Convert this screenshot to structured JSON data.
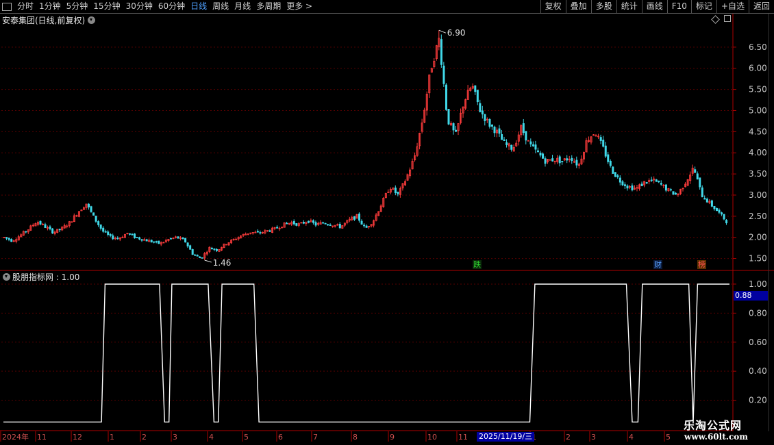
{
  "toolbar": {
    "left_items": [
      {
        "label": "分时"
      },
      {
        "label": "1分钟"
      },
      {
        "label": "5分钟"
      },
      {
        "label": "15分钟"
      },
      {
        "label": "30分钟"
      },
      {
        "label": "60分钟"
      },
      {
        "label": "日线",
        "active": true
      },
      {
        "label": "周线"
      },
      {
        "label": "月线"
      },
      {
        "label": "多周期"
      },
      {
        "label": "更多 >"
      }
    ],
    "right_items": [
      {
        "label": "复权"
      },
      {
        "label": "叠加"
      },
      {
        "label": "多股"
      },
      {
        "label": "统计"
      },
      {
        "label": "画线"
      },
      {
        "label": "F10"
      },
      {
        "label": "标记"
      },
      {
        "label": "+自选"
      },
      {
        "label": "返回"
      }
    ]
  },
  "main_panel": {
    "title": "安泰集团(日线,前复权)",
    "max_label": "6.90",
    "min_label": "1.46",
    "signals": [
      {
        "text": "跌",
        "color": "#2fd52f",
        "bg": "#0a2a0a"
      },
      {
        "text": "财",
        "color": "#5aa0ff",
        "bg": "#0a1a3a"
      },
      {
        "text": "榜",
        "color": "#ff5050",
        "bg": "#5a3000"
      }
    ]
  },
  "indicator_panel": {
    "title": "股朋指标网 : 1.00",
    "current_value": "0.88"
  },
  "watermark": {
    "line1": "乐淘公式网",
    "line2": "www.60lt.com"
  },
  "date_axis": {
    "highlight": "2025/11/19/三",
    "labels": [
      "2024年",
      "11",
      "12",
      "1",
      "2",
      "3",
      "4",
      "5",
      "6",
      "7",
      "8",
      "9",
      "10",
      "11",
      "1",
      "2",
      "3",
      "4",
      "5"
    ]
  },
  "colors": {
    "up": "#ff3c3c",
    "down": "#40d8e8",
    "grid": "#5a0000",
    "axis": "#b00000",
    "line": "#ffffff"
  },
  "chart_data": [
    {
      "type": "candlestick",
      "title": "安泰集团(日线,前复权)",
      "y_ticks": [
        1.5,
        2.0,
        2.5,
        3.0,
        3.5,
        4.0,
        4.5,
        5.0,
        5.5,
        6.0,
        6.5
      ],
      "y_tick_labels": [
        "1.50",
        "2.00",
        "2.50",
        "3.00",
        "3.50",
        "4.00",
        "4.50",
        "5.00",
        "5.50",
        "6.00",
        "6.50"
      ],
      "ylim": [
        1.25,
        7.0
      ],
      "x_labels": [
        "2024年",
        "11",
        "12",
        "1",
        "2",
        "3",
        "4",
        "5",
        "6",
        "7",
        "8",
        "9",
        "10",
        "11",
        "1",
        "2",
        "3",
        "4",
        "5"
      ],
      "close_path": [
        2.0,
        1.92,
        2.05,
        2.2,
        2.38,
        2.25,
        2.12,
        2.2,
        2.35,
        2.6,
        2.8,
        2.45,
        2.15,
        2.0,
        1.98,
        2.1,
        2.0,
        1.95,
        1.9,
        1.85,
        1.95,
        2.0,
        1.92,
        1.6,
        1.5,
        1.75,
        1.7,
        1.85,
        1.95,
        2.05,
        2.12,
        2.1,
        2.15,
        2.2,
        2.3,
        2.35,
        2.3,
        2.4,
        2.3,
        2.35,
        2.3,
        2.25,
        2.4,
        2.5,
        2.2,
        2.4,
        2.8,
        3.2,
        3.0,
        3.4,
        3.9,
        4.8,
        6.0,
        6.7,
        4.8,
        4.4,
        5.2,
        5.6,
        5.0,
        4.7,
        4.5,
        4.2,
        4.1,
        4.6,
        4.2,
        4.0,
        3.8,
        3.85,
        3.8,
        3.9,
        3.7,
        4.3,
        4.5,
        4.1,
        3.6,
        3.35,
        3.2,
        3.15,
        3.3,
        3.35,
        3.25,
        3.1,
        3.0,
        3.3,
        3.65,
        3.0,
        2.8,
        2.6,
        2.38
      ],
      "max": 6.9,
      "min": 1.46
    },
    {
      "type": "line",
      "title": "股朋指标网 : 1.00",
      "y_ticks": [
        0.2,
        0.4,
        0.6,
        0.8,
        1.0
      ],
      "y_tick_labels": [
        "0.20",
        "0.40",
        "0.60",
        "0.80",
        "1.00"
      ],
      "ylim": [
        0.0,
        1.08
      ],
      "current": 0.88,
      "series": [
        {
          "steps": [
            [
              0,
              0
            ],
            [
              0.135,
              0
            ],
            [
              0.14,
              1
            ],
            [
              0.215,
              1
            ],
            [
              0.222,
              0
            ],
            [
              0.228,
              0
            ],
            [
              0.232,
              1
            ],
            [
              0.282,
              1
            ],
            [
              0.29,
              0
            ],
            [
              0.296,
              0
            ],
            [
              0.301,
              1
            ],
            [
              0.345,
              1
            ],
            [
              0.352,
              0
            ],
            [
              0.725,
              0
            ],
            [
              0.732,
              1
            ],
            [
              0.858,
              1
            ],
            [
              0.866,
              0
            ],
            [
              0.874,
              0
            ],
            [
              0.88,
              1
            ],
            [
              0.944,
              1
            ],
            [
              0.95,
              0.04
            ],
            [
              0.956,
              1
            ],
            [
              1.0,
              1
            ]
          ]
        }
      ]
    }
  ]
}
